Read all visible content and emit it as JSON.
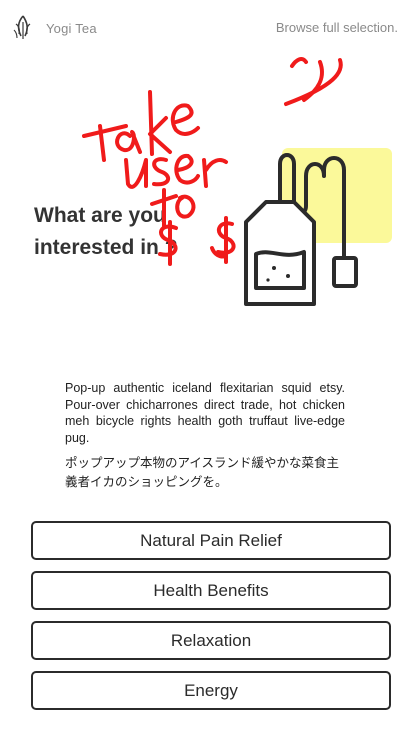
{
  "header": {
    "logo_icon": "leaf-feather-logo-icon",
    "brand_name": "Yogi Tea",
    "browse_link": "Browse full selection."
  },
  "hero": {
    "title_line1": "What are you",
    "title_line2": "interested in ?",
    "illustration_icon": "tea-bag-icon",
    "accent_color": "#fbf99a"
  },
  "annotation": {
    "handwritten_note": "take user to $$",
    "ink_color": "#f01b1b"
  },
  "description": {
    "english": "Pop-up authentic iceland flexitarian squid etsy. Pour-over chicharrones direct trade, hot chicken meh bicycle rights health goth truffaut live-edge pug.",
    "japanese": "ポップアップ本物のアイスランド緩やかな菜食主義者イカのショッピングを。"
  },
  "options": [
    {
      "label": "Natural Pain Relief"
    },
    {
      "label": "Health Benefits"
    },
    {
      "label": "Relaxation"
    },
    {
      "label": "Energy"
    }
  ]
}
